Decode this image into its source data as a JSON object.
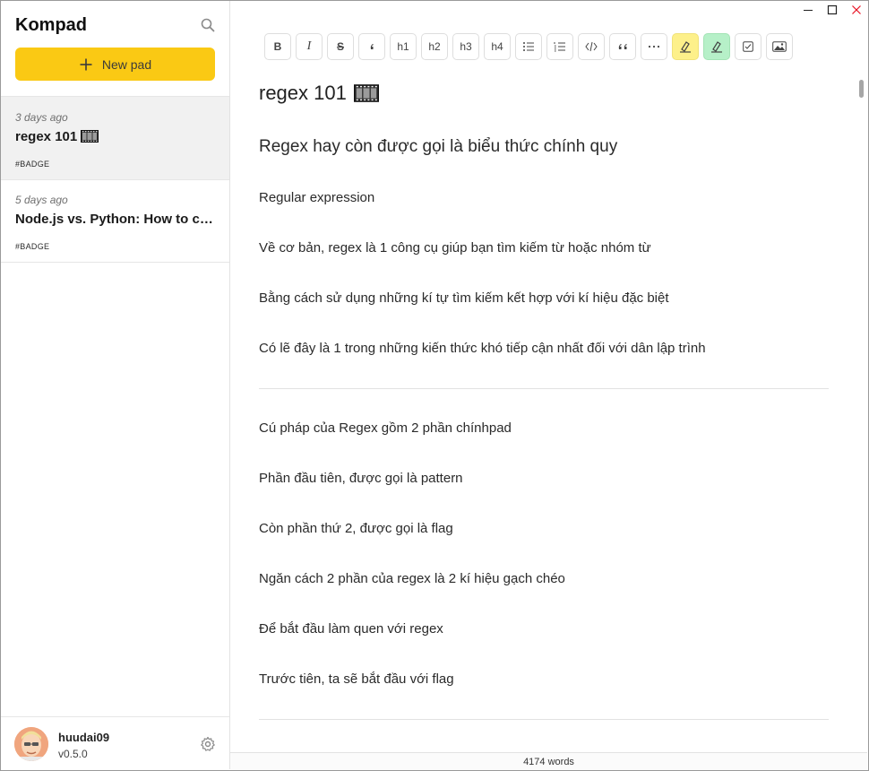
{
  "window": {
    "controls": {
      "minimize_icon": "minimize-icon",
      "maximize_icon": "maximize-icon",
      "close_icon": "close-icon",
      "close_color": "#e81123"
    }
  },
  "sidebar": {
    "app_title": "Kompad",
    "search_icon": "search-icon",
    "new_pad_label": "New pad",
    "new_pad_color": "#fac914",
    "pads": [
      {
        "date": "3 days ago",
        "title": "regex 101",
        "icon": "film-frames-icon",
        "badge": "#BADGE",
        "active": true
      },
      {
        "date": "5 days ago",
        "title": "Node.js vs. Python: How to choose",
        "badge": "#BADGE",
        "active": false
      }
    ],
    "user": {
      "name": "huudai09",
      "version": "v0.5.0"
    }
  },
  "toolbar": {
    "bold": "B",
    "italic": "I",
    "strike": "S",
    "h1": "h1",
    "h2": "h2",
    "h3": "h3",
    "h4": "h4",
    "items": [
      "bold",
      "italic",
      "strikethrough",
      "inline-quote",
      "h1",
      "h2",
      "h3",
      "h4",
      "bullet-list",
      "ordered-list",
      "code",
      "blockquote",
      "more",
      "highlight-yellow",
      "highlight-green",
      "checkbox",
      "image"
    ],
    "highlight_colors": {
      "yellow": "#fdf08a",
      "green": "#b6f0c8"
    }
  },
  "document": {
    "title": "regex 101",
    "lines": [
      "Regex hay còn được gọi là biểu thức chính quy",
      "Regular expression",
      "Về cơ bản, regex là 1 công cụ giúp bạn tìm kiếm từ hoặc nhóm từ",
      "Bằng cách sử dụng những kí tự tìm kiếm kết hợp với kí hiệu đặc biệt",
      "Có lẽ đây là 1 trong những kiến thức khó tiếp cận nhất đối với dân lập trình",
      "Cú pháp của Regex gồm 2 phần chínhpad",
      "Phần đầu tiên, được gọi là pattern",
      "Còn phần thứ 2, được gọi là flag",
      "Ngăn cách 2 phần của regex là 2 kí hiệu gạch chéo",
      "Để bắt đầu làm quen với regex",
      "Trước tiên, ta sẽ bắt đầu với flag"
    ]
  },
  "status": {
    "word_count": "4174 words"
  }
}
